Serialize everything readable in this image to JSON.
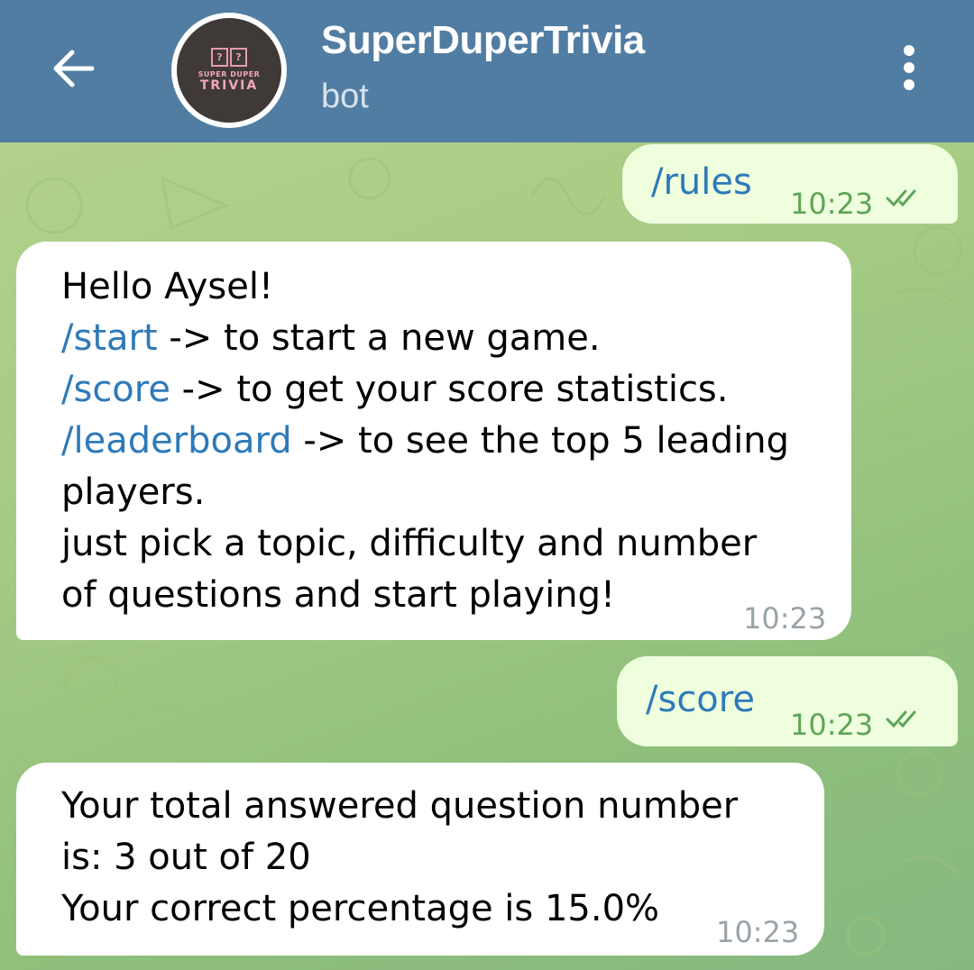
{
  "header": {
    "back_icon": "arrow-left-icon",
    "chat_title": "SuperDuperTrivia",
    "chat_subtitle": "bot",
    "avatar_text": {
      "top": "SUPER DUPER",
      "main": "TRIVIA",
      "dice": [
        "?",
        "?"
      ]
    },
    "menu_icon": "more-vertical-icon"
  },
  "messages": [
    {
      "direction": "out",
      "text": "/rules",
      "time": "10:23",
      "status_icon": "double-check-icon"
    },
    {
      "direction": "in",
      "greeting": "Hello Aysel!",
      "lines": [
        {
          "cmd": "/start",
          "desc": " -> to start a new game."
        },
        {
          "cmd": "/score",
          "desc": " -> to get your score statistics."
        },
        {
          "cmd": "/leaderboard",
          "desc": " -> to see the top 5 leading"
        }
      ],
      "line4": "players.",
      "line5": "just pick a topic, difficulty and number",
      "line6": "of questions and start playing!",
      "time": "10:23"
    },
    {
      "direction": "out",
      "text": "/score",
      "time": "10:23",
      "status_icon": "double-check-icon"
    },
    {
      "direction": "in",
      "line1": "Your total answered question number",
      "line2": "is: 3 out of 20",
      "line3": "Your correct percentage is 15.0%",
      "time": "10:23"
    }
  ],
  "colors": {
    "header": "#517da2",
    "incoming_bubble": "#ffffff",
    "outgoing_bubble": "#efffde",
    "command_link": "#2e7ab8",
    "read_ticks": "#5ea558"
  }
}
